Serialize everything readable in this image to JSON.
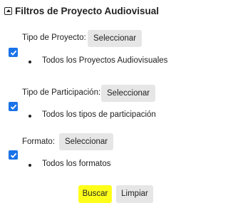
{
  "header": {
    "title": "Filtros de Proyecto Audiovisual"
  },
  "filters": [
    {
      "label": "Tipo de Proyecto:",
      "button_label": "Seleccionar",
      "checked": true,
      "selection": "Todos los Proyectos Audiovisuales"
    },
    {
      "label": "Tipo de Participación:",
      "button_label": "Seleccionar",
      "checked": true,
      "selection": "Todos los tipos de participación"
    },
    {
      "label": "Formato:",
      "button_label": "Seleccionar",
      "checked": true,
      "selection": "Todos los formatos"
    }
  ],
  "actions": {
    "search_label": "Buscar",
    "clear_label": "Limpiar"
  },
  "colors": {
    "checkbox": "#1a73e8",
    "search_button": "#ffff1a",
    "secondary_button": "#e6e6e6"
  }
}
